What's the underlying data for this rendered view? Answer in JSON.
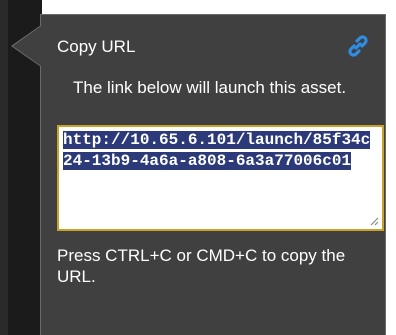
{
  "popover": {
    "title": "Copy URL",
    "description": "The link below will launch this asset.",
    "url": "http://10.65.6.101/launch/85f34c24-13b9-4a6a-a808-6a3a77006c01",
    "hint": "Press CTRL+C or CMD+C to copy the URL."
  },
  "colors": {
    "panel_bg": "#404040",
    "link_icon": "#2f8de4",
    "field_border": "#c9a227",
    "selection_bg": "#2c3a7a"
  },
  "icons": {
    "link": "link-icon",
    "resize": "resize-grip-icon"
  }
}
